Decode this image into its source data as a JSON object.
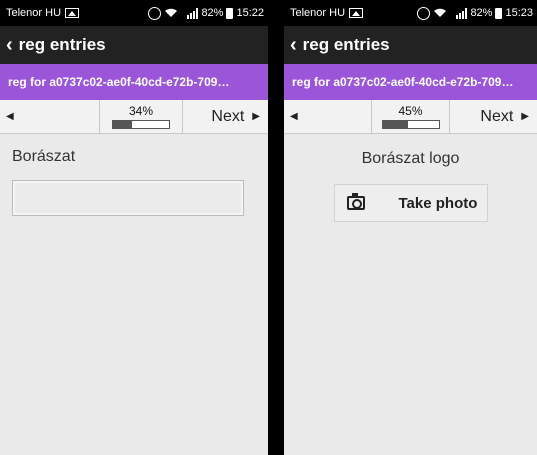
{
  "left_screen": {
    "statusbar": {
      "carrier": "Telenor HU",
      "battery": "82%",
      "time": "15:22"
    },
    "actionbar": {
      "back_icon": "‹",
      "title": "reg entries"
    },
    "subtitle": "reg for a0737c02-ae0f-40cd-e72b-709…",
    "nav": {
      "prev_icon": "◀",
      "progress_text": "34%",
      "progress_value": 0.34,
      "next_label": "Next",
      "next_icon": "▶"
    },
    "field": {
      "label": "Borászat",
      "value": ""
    }
  },
  "right_screen": {
    "statusbar": {
      "carrier": "Telenor HU",
      "battery": "82%",
      "time": "15:23"
    },
    "actionbar": {
      "back_icon": "‹",
      "title": "reg entries"
    },
    "subtitle": "reg for a0737c02-ae0f-40cd-e72b-709…",
    "nav": {
      "prev_icon": "◀",
      "progress_text": "45%",
      "progress_value": 0.45,
      "next_label": "Next",
      "next_icon": "▶"
    },
    "field": {
      "label": "Borászat logo",
      "button_label": "Take photo",
      "button_icon": "camera-icon"
    }
  },
  "colors": {
    "accent": "#9a55d8",
    "actionbar": "#222222",
    "background": "#eaeaea"
  }
}
